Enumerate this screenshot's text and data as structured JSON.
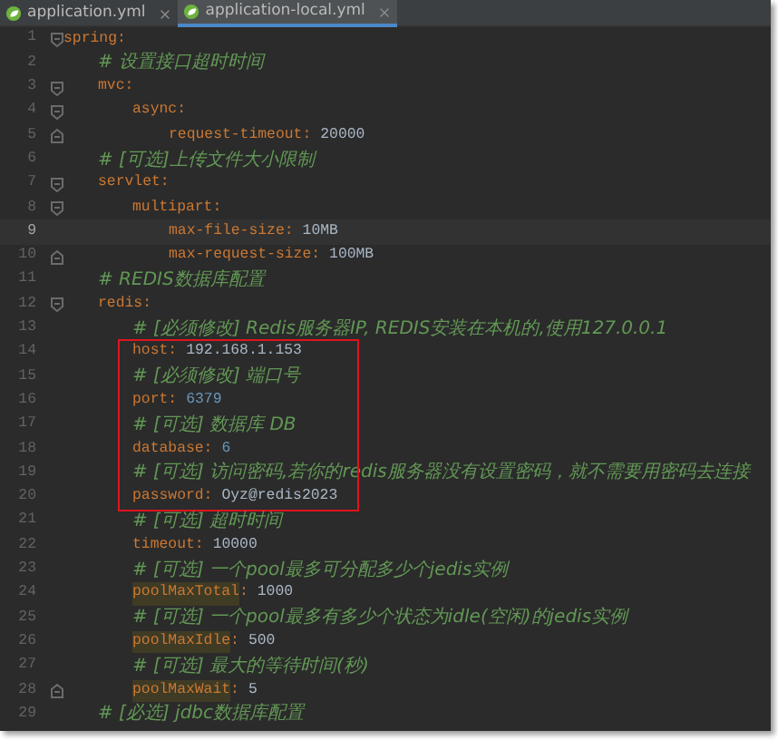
{
  "tabs": [
    {
      "label": "application.yml",
      "selected": false
    },
    {
      "label": "application-local.yml",
      "selected": true
    }
  ],
  "lines": [
    {
      "number": "1",
      "key": "spring:",
      "fold_start": true,
      "children": [
        {
          "number": "2",
          "comment": "# 设置接口超时时间"
        },
        {
          "number": "3",
          "key": "mvc:",
          "fold_start": true,
          "children": [
            {
              "number": "4",
              "key": "async:",
              "fold_start": true,
              "children": [
                {
                  "number": "5",
                  "key": "request-timeout:",
                  "value": "20000",
                  "fold_end": true
                }
              ]
            }
          ]
        },
        {
          "number": "6",
          "comment": "# [可选]上传文件大小限制"
        },
        {
          "number": "7",
          "key": "servlet:",
          "fold_start": true,
          "children": [
            {
              "number": "8",
              "key": "multipart:",
              "fold_start": true,
              "children": [
                {
                  "number": "9",
                  "key": "max-file-size:",
                  "value": "10MB",
                  "current": true
                },
                {
                  "number": "10",
                  "key": "max-request-size:",
                  "value": "100MB",
                  "fold_end": true
                }
              ]
            }
          ]
        },
        {
          "number": "11",
          "comment": "# REDIS数据库配置"
        },
        {
          "number": "12",
          "key": "redis:",
          "fold_start": true,
          "children": [
            {
              "kind": "line",
              "number": "13",
              "comment": "# [必须修改] Redis服务器IP, REDIS安装在本机的,使用127.0.0.1"
            },
            {
              "kind": "frame",
              "lines": [
                {
                  "number": "14",
                  "key": "host:",
                  "value": "192.168.1.153"
                },
                {
                  "number": "15",
                  "comment": "# [必须修改] 端口号"
                },
                {
                  "number": "16",
                  "key": "port:",
                  "value": "6379",
                  "numeric": true
                },
                {
                  "number": "17",
                  "comment": "# [可选] 数据库 DB"
                },
                {
                  "number": "18",
                  "key": "database:",
                  "value": "6",
                  "numeric": true
                },
                {
                  "number": "19",
                  "comment": "# [可选] 访问密码,若你的redis服务器没有设置密码，就不需要用密码去连接"
                },
                {
                  "number": "20",
                  "key": "password:",
                  "value": "Oyz@redis2023"
                }
              ]
            },
            {
              "kind": "line",
              "number": "21",
              "comment": "# [可选] 超时时间"
            },
            {
              "kind": "line",
              "number": "22",
              "key": "timeout:",
              "value": "10000"
            },
            {
              "kind": "line",
              "number": "23",
              "comment": "# [可选] 一个pool最多可分配多少个jedis实例"
            },
            {
              "kind": "line",
              "number": "24",
              "key": "poolMaxTotal",
              "key_suffix": ":",
              "value": "1000",
              "warning": true
            },
            {
              "kind": "line",
              "number": "25",
              "comment": "# [可选] 一个pool最多有多少个状态为idle(空闲)的jedis实例"
            },
            {
              "kind": "line",
              "number": "26",
              "key": "poolMaxIdle",
              "key_suffix": ":",
              "value": "500",
              "warning": true
            },
            {
              "kind": "line",
              "number": "27",
              "comment": "# [可选] 最大的等待时间(秒)"
            },
            {
              "kind": "line",
              "number": "28",
              "key": "poolMaxWait",
              "key_suffix": ":",
              "value": "5",
              "warning": true,
              "fold_end": true
            }
          ]
        },
        {
          "number": "29",
          "comment": "# [必选] jdbc数据库配置"
        }
      ]
    }
  ]
}
